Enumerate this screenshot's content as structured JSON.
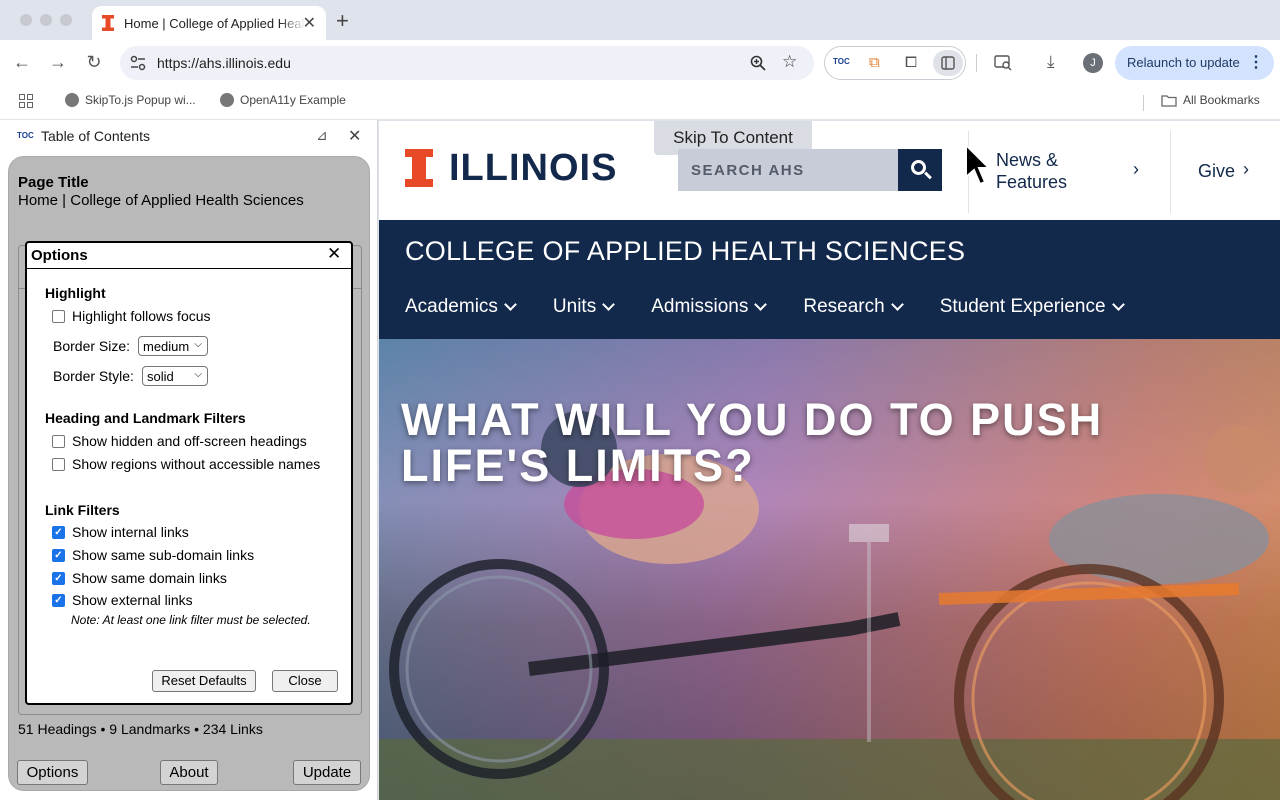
{
  "browser": {
    "tab_title": "Home | College of Applied Health Sciences",
    "url": "https://ahs.illinois.edu",
    "relaunch_label": "Relaunch to update",
    "avatar_letter": "J",
    "toc_ext_label": "TOC",
    "bookmarks": [
      "SkipTo.js Popup wi...",
      "OpenA11y Example"
    ],
    "all_bookmarks": "All Bookmarks"
  },
  "sidepanel": {
    "logo": "TOC",
    "title": "Table of Contents",
    "page_title_label": "Page Title",
    "page_title_value": "Home | College of Applied Health Sciences",
    "counts": "51 Headings • 9 Landmarks • 234 Links",
    "buttons": {
      "options": "Options",
      "about": "About",
      "update": "Update"
    }
  },
  "options_dialog": {
    "title": "Options",
    "highlight": {
      "heading": "Highlight",
      "follows_focus": {
        "label": "Highlight follows focus",
        "checked": false
      },
      "border_size_label": "Border Size:",
      "border_size_value": "medium",
      "border_style_label": "Border Style:",
      "border_style_value": "solid"
    },
    "filters": {
      "heading": "Heading and Landmark Filters",
      "hidden_headings": {
        "label": "Show hidden and off-screen headings",
        "checked": false
      },
      "unnamed_regions": {
        "label": "Show regions without accessible names",
        "checked": false
      }
    },
    "links": {
      "heading": "Link Filters",
      "internal": {
        "label": "Show internal links",
        "checked": true
      },
      "subdomain": {
        "label": "Show same sub-domain links",
        "checked": true
      },
      "domain": {
        "label": "Show same domain links",
        "checked": true
      },
      "external": {
        "label": "Show external links",
        "checked": true
      },
      "note": "Note: At least one link filter must be selected."
    },
    "reset_label": "Reset Defaults",
    "close_label": "Close"
  },
  "webpage": {
    "logo_text": "ILLINOIS",
    "skip_to": "Skip To Content",
    "search_placeholder": "SEARCH AHS",
    "news_label": "News &\nFeatures",
    "give_label": "Give",
    "college_name": "COLLEGE OF APPLIED HEALTH SCIENCES",
    "nav": [
      "Academics",
      "Units",
      "Admissions",
      "Research",
      "Student Experience"
    ],
    "hero_headline": "WHAT WILL YOU DO TO PUSH LIFE'S LIMITS?",
    "brand_orange": "#e84a27",
    "brand_blue": "#13294b"
  }
}
